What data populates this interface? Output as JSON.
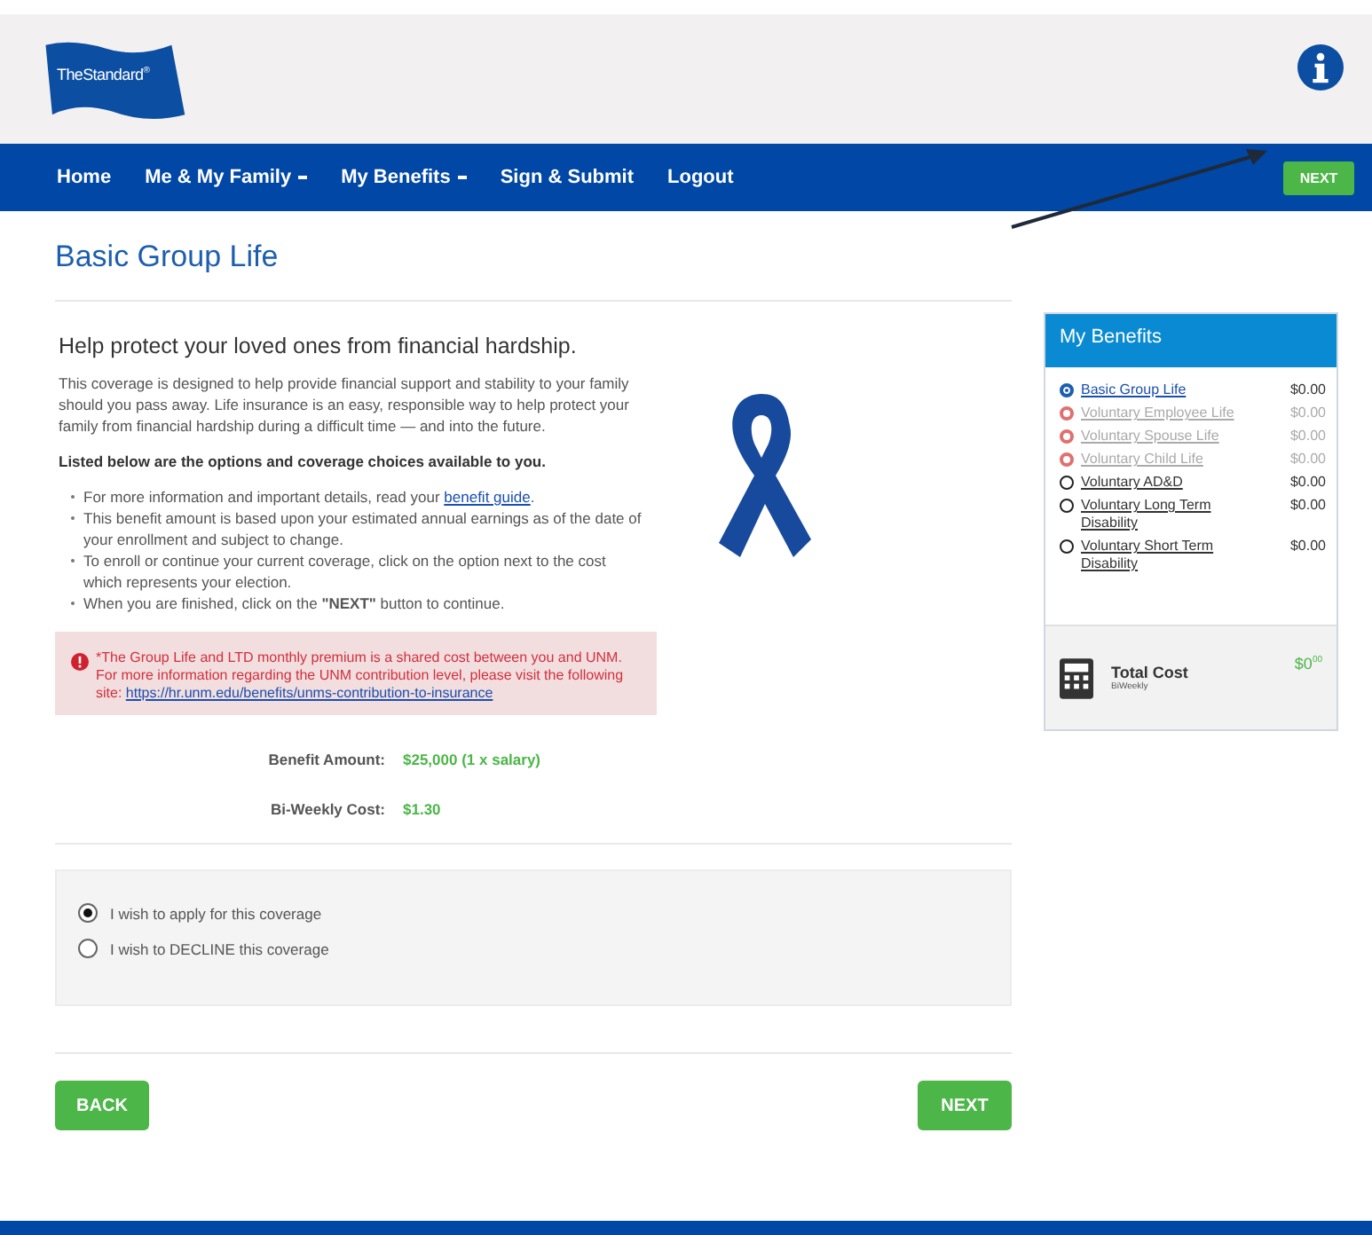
{
  "logo": {
    "text": "TheStandard",
    "mark": "®"
  },
  "nav": [
    {
      "label": "Home",
      "dropdown": false
    },
    {
      "label": "Me & My Family",
      "dropdown": true
    },
    {
      "label": "My Benefits",
      "dropdown": true
    },
    {
      "label": "Sign & Submit",
      "dropdown": false
    },
    {
      "label": "Logout",
      "dropdown": false
    }
  ],
  "nav_button": "NEXT",
  "page_title": "Basic Group Life",
  "heading": "Help protect your loved ones from financial hardship.",
  "intro": "This coverage is designed to help provide financial support and stability to your family should you pass away. Life insurance is an easy, responsible way to help protect your family from financial hardship during a difficult time — and into the future.",
  "list_heading": "Listed below are the options and coverage choices available to you.",
  "bullets": [
    {
      "text": "For more information and important details, read your ",
      "link": "benefit guide",
      "after": "."
    },
    {
      "text": "This benefit amount is based upon your estimated annual earnings as of the date of your enrollment and subject to change."
    },
    {
      "text": "To enroll or continue your current coverage, click on the option next to the cost which represents your election."
    },
    {
      "text": "When you are finished, click on the **\"NEXT\"** button to continue."
    }
  ],
  "alert": {
    "text": "*The Group Life and LTD monthly premium is a shared cost between you and UNM. For more information regarding the UNM contribution level, please visit the following site: ",
    "link": "https://hr.unm.edu/benefits/unms-contribution-to-insurance"
  },
  "details": [
    {
      "label": "Benefit Amount:",
      "value": "$25,000 (1 x salary)"
    },
    {
      "label": "Bi-Weekly Cost:",
      "value": "$1.30"
    }
  ],
  "options": [
    {
      "label": "I wish to apply for this coverage",
      "selected": true
    },
    {
      "label": "I wish to DECLINE this coverage",
      "selected": false
    }
  ],
  "buttons": {
    "back": "BACK",
    "next": "NEXT"
  },
  "sidebar": {
    "title": "My Benefits",
    "items": [
      {
        "name": "Basic Group Life",
        "cost": "$0.00",
        "kind": "current"
      },
      {
        "name": "Voluntary Employee Life",
        "cost": "$0.00",
        "kind": "unavailable"
      },
      {
        "name": "Voluntary Spouse Life",
        "cost": "$0.00",
        "kind": "unavailable"
      },
      {
        "name": "Voluntary Child Life",
        "cost": "$0.00",
        "kind": "unavailable"
      },
      {
        "name": "Voluntary AD&D",
        "cost": "$0.00",
        "kind": "open"
      },
      {
        "name": "Voluntary Long Term Disability",
        "cost": "$0.00",
        "kind": "open"
      },
      {
        "name": "Voluntary Short Term Disability",
        "cost": "$0.00",
        "kind": "open"
      }
    ],
    "total_label": "Total Cost",
    "total_period": "BiWeekly",
    "total_value": "$0",
    "total_cents": "00"
  }
}
